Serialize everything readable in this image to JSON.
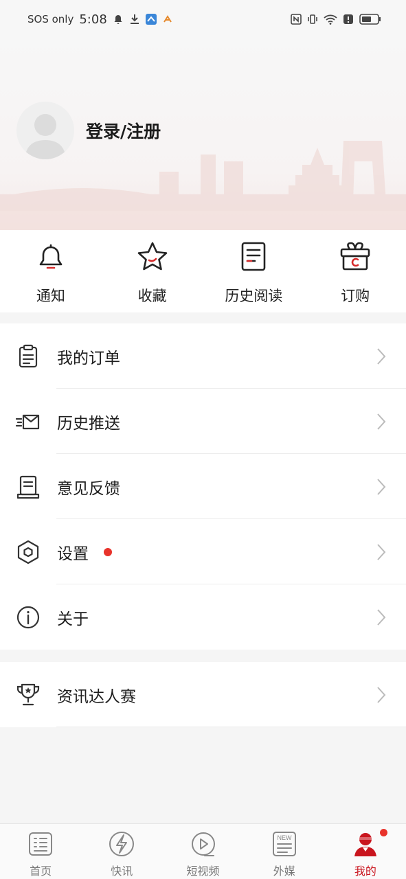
{
  "status_bar": {
    "carrier": "SOS only",
    "time": "5:08",
    "icons": [
      "bell-icon",
      "download-icon",
      "app-icon",
      "app2-icon",
      "nfc-icon",
      "vibrate-icon",
      "wifi-icon",
      "alert-icon",
      "battery-icon"
    ]
  },
  "profile": {
    "login_label": "登录/注册"
  },
  "quick_actions": [
    {
      "label": "通知",
      "icon": "bell-icon"
    },
    {
      "label": "收藏",
      "icon": "star-icon"
    },
    {
      "label": "历史阅读",
      "icon": "history-doc-icon"
    },
    {
      "label": "订购",
      "icon": "gift-icon"
    }
  ],
  "menu": [
    {
      "label": "我的订单",
      "icon": "clipboard-icon"
    },
    {
      "label": "历史推送",
      "icon": "send-mail-icon"
    },
    {
      "label": "意见反馈",
      "icon": "feedback-icon"
    },
    {
      "label": "设置",
      "icon": "hexagon-gear-icon",
      "badge": true
    },
    {
      "label": "关于",
      "icon": "info-icon"
    }
  ],
  "menu_extra": [
    {
      "label": "资讯达人赛",
      "icon": "trophy-icon"
    }
  ],
  "bottom_nav": [
    {
      "label": "首页",
      "icon": "home-doc-icon"
    },
    {
      "label": "快讯",
      "icon": "lightning-icon"
    },
    {
      "label": "短视频",
      "icon": "play-icon"
    },
    {
      "label": "外媒",
      "icon": "new-doc-icon"
    },
    {
      "label": "我的",
      "icon": "user-icon",
      "active": true,
      "badge": true
    }
  ],
  "colors": {
    "accent": "#c9151e",
    "badge": "#e8332b",
    "background": "#f5f5f5"
  }
}
